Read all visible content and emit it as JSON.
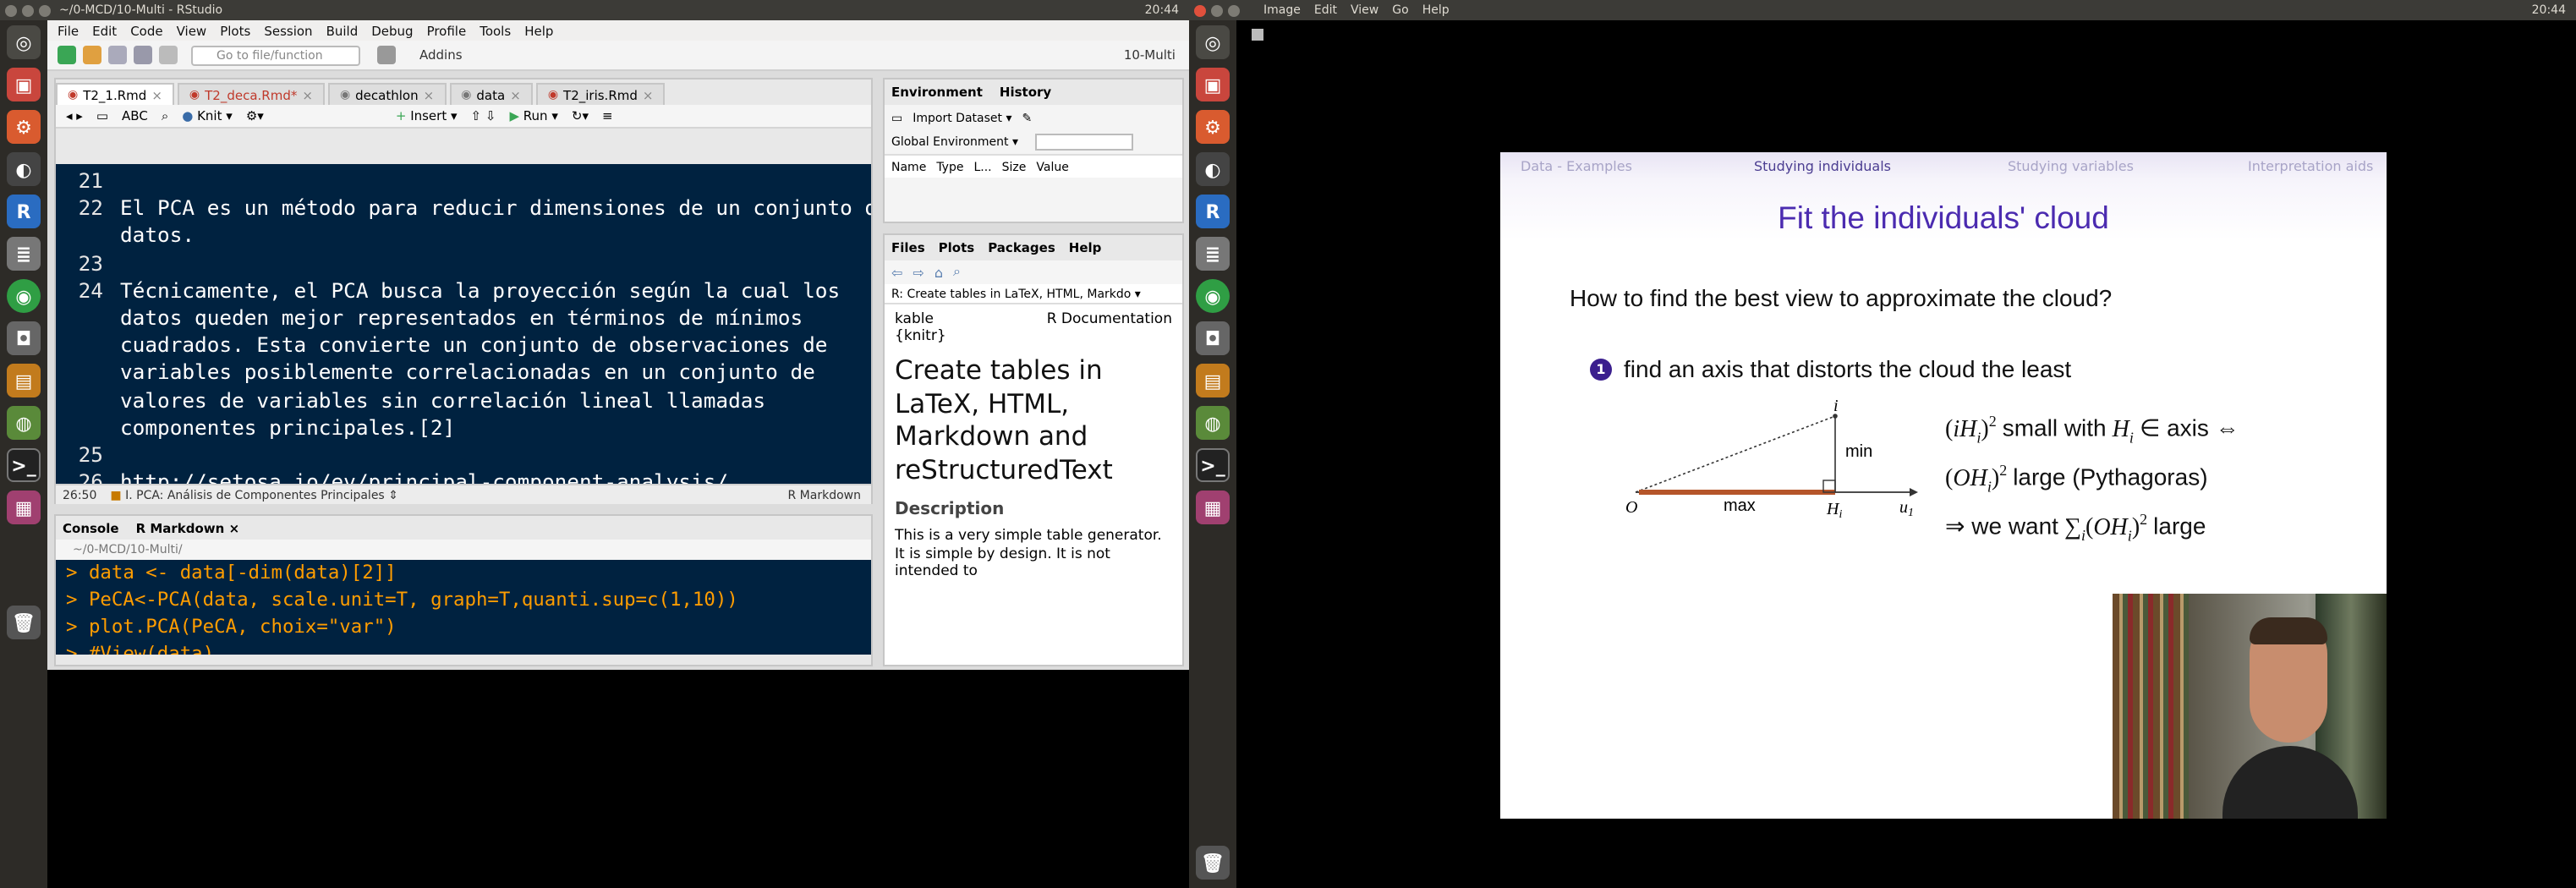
{
  "left_window": {
    "title": "~/0-MCD/10-Multi - RStudio",
    "menu": [
      "File",
      "Edit",
      "Code",
      "View",
      "Plots",
      "Session",
      "Build",
      "Debug",
      "Profile",
      "Tools",
      "Help"
    ],
    "go_to_placeholder": "Go to file/function",
    "addins": "Addins",
    "project": "10-Multi",
    "editor_tabs": [
      "T2_1.Rmd",
      "T2_deca.Rmd*",
      "decathlon",
      "data",
      "T2_iris.Rmd"
    ],
    "editor_toolbar": {
      "knit": "Knit",
      "insert": "Insert",
      "run": "Run"
    },
    "editor_lines": [
      {
        "n": "21",
        "t": ""
      },
      {
        "n": "22",
        "t": "El PCA es un método para reducir dimensiones de un conjunto de"
      },
      {
        "n": "",
        "t": "datos."
      },
      {
        "n": "23",
        "t": ""
      },
      {
        "n": "24",
        "t": "Técnicamente, el PCA busca la proyección según la cual los"
      },
      {
        "n": "",
        "t": "datos queden mejor representados en términos de mínimos"
      },
      {
        "n": "",
        "t": "cuadrados. Esta convierte un conjunto de observaciones de"
      },
      {
        "n": "",
        "t": "variables posiblemente correlacionadas en un conjunto de"
      },
      {
        "n": "",
        "t": "valores de variables sin correlación lineal llamadas"
      },
      {
        "n": "",
        "t": "componentes principales.[2]"
      },
      {
        "n": "25",
        "t": ""
      },
      {
        "n": "26",
        "t": "http://setosa.io/ev/principal-component-analysis/"
      }
    ],
    "status": {
      "pos": "26:50",
      "section": "I. PCA: Análisis de Componentes Principales",
      "mode": "R Markdown"
    },
    "console_tabs": [
      "Console",
      "R Markdown"
    ],
    "console_path": "~/0-MCD/10-Multi/",
    "console_lines": [
      "> data <- data[-dim(data)[2]]",
      "> PeCA<-PCA(data, scale.unit=T, graph=T,quanti.sup=c(1,10))",
      "> plot.PCA(PeCA, choix=\"var\")",
      "> #View(data)"
    ],
    "env_tabs": [
      "Environment",
      "History"
    ],
    "import_dataset": "Import Dataset",
    "global_env": "Global Environment",
    "env_columns": [
      "Name",
      "Type",
      "L...",
      "Size",
      "Value"
    ],
    "files_tabs": [
      "Files",
      "Plots",
      "Packages",
      "Help"
    ],
    "help_topic": "R: Create tables in LaTeX, HTML, Markdo",
    "help_kable": "kable {knitr}",
    "help_rdoc": "R Documentation",
    "help_title": "Create tables in LaTeX, HTML, Markdown and reStructuredText",
    "help_desc_heading": "Description",
    "help_desc": "This is a very simple table generator. It is simple by design. It is not intended to"
  },
  "right_window": {
    "menu": [
      "Image",
      "Edit",
      "View",
      "Go",
      "Help"
    ],
    "clock": "20:44",
    "nav_tabs": [
      "Data - Examples",
      "Studying individuals",
      "Studying variables",
      "Interpretation aids"
    ],
    "slide_title": "Fit the individuals' cloud",
    "question": "How to find the best view to approximate the cloud?",
    "bullet_num": "1",
    "bullet": "find an axis that distorts the cloud the least",
    "fig_labels": {
      "i": "i",
      "min": "min",
      "O": "O",
      "max": "max",
      "Hi": "H",
      "u1": "u"
    },
    "eq1": "small with",
    "eq1b": "∈ axis ⇔",
    "eq2": "large (Pythagoras)",
    "eq3a": "⇒ we want",
    "eq3b": "large"
  },
  "colors": {
    "title": "#4b2bb0",
    "nav_current": "#3b2f82",
    "editor_bg": "#002240",
    "console_text": "#ff9d00"
  }
}
